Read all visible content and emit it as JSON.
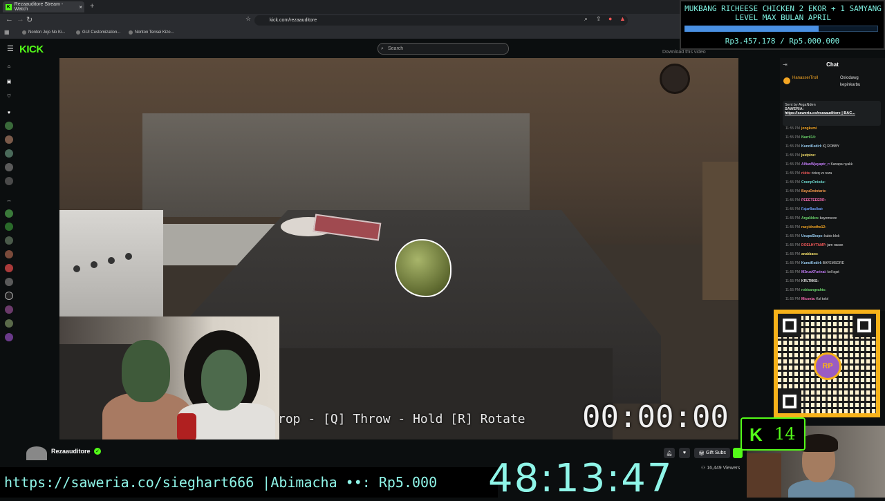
{
  "browser": {
    "tab_title": "Rezaauditore Stream - Watch",
    "url": "kick.com/rezaauditore",
    "bookmarks": [
      "Nonton Jojo No Ki...",
      "GUI Customization...",
      "Nonton Tensei Kizo..."
    ]
  },
  "kick": {
    "logo": "KICK",
    "search_placeholder": "Search",
    "download_hint": "Download this video"
  },
  "game": {
    "controls_hint": "rop - [Q] Throw - Hold [R] Rotate",
    "timer": "00:00:00"
  },
  "stream": {
    "streamer": "Rezaauditore",
    "gift_subs": "Gift Subs",
    "viewers": "16,449 Viewers"
  },
  "chat": {
    "title": "Chat",
    "leaders": [
      "HanasserTroll",
      "Oslodawg",
      "kepinkarbu"
    ],
    "pinned_sender": "Sent by ArgaNden",
    "pinned_label": "SAWERIA:",
    "pinned_url": "https://saweria.co/rezaauditore | BAC...",
    "messages": [
      {
        "time": "11:55 PM",
        "user": "jongkumi",
        "text": "",
        "color": "#f5a623"
      },
      {
        "time": "11:55 PM",
        "user": "Nazril14:",
        "text": "",
        "color": "#6ad16a"
      },
      {
        "time": "11:55 PM",
        "user": "KunciKedirI:",
        "text": "IQ ROBBY",
        "color": "#9ad0f5"
      },
      {
        "time": "11:55 PM",
        "user": "justpine:",
        "text": "",
        "color": "#f5e06a"
      },
      {
        "time": "11:55 PM",
        "user": "AlfianWjayaptr_r:",
        "text": "Kanapa nyakk",
        "color": "#c07af5"
      },
      {
        "time": "11:55 PM",
        "user": "rkkts:",
        "text": "rizieq vs reza",
        "color": "#f55a5a"
      },
      {
        "time": "11:55 PM",
        "user": "CrampOnioda:",
        "text": "",
        "color": "#6ad1c7"
      },
      {
        "time": "11:55 PM",
        "user": "BayuDwintaris:",
        "text": "",
        "color": "#f59a4a"
      },
      {
        "time": "11:55 PM",
        "user": "PEEETEEERR:",
        "text": "",
        "color": "#f56ab0"
      },
      {
        "time": "11:55 PM",
        "user": "FajarBaslkat:",
        "text": "",
        "color": "#6a9af5"
      },
      {
        "time": "11:55 PM",
        "user": "ArgaNden:",
        "text": "bayemsore",
        "color": "#6ad16a"
      },
      {
        "time": "11:55 PM",
        "user": "rasyidnotho12:",
        "text": "",
        "color": "#f5a623"
      },
      {
        "time": "11:55 PM",
        "user": "UcupsSkopc:",
        "text": "kubis blok",
        "color": "#9ad0f5"
      },
      {
        "time": "11:55 PM",
        "user": "DOELHYTAMP:",
        "text": "jam rawan",
        "color": "#f55a5a"
      },
      {
        "time": "11:55 PM",
        "user": "anakbaes:",
        "text": "",
        "color": "#f5e06a"
      },
      {
        "time": "11:55 PM",
        "user": "KunciKedirI:",
        "text": "BAYEMSORE",
        "color": "#9ad0f5"
      },
      {
        "time": "11:55 PM",
        "user": "M3ruaXFurinai:",
        "text": "kol bgst",
        "color": "#c07af5"
      },
      {
        "time": "11:55 PM",
        "user": "KRLTM0S:",
        "text": "",
        "color": "#ddd"
      },
      {
        "time": "11:55 PM",
        "user": "robisangeahts:",
        "text": "",
        "color": "#6ad16a"
      },
      {
        "time": "11:55 PM",
        "user": "Miconia:",
        "text": "Kol tolol",
        "color": "#f56ab0"
      }
    ]
  },
  "overlay": {
    "goal_title": "MUKBANG RICHEESE CHICKEN 2 EKOR + 1 SAMYANG LEVEL MAX BULAN APRIL",
    "goal_amount": "Rp3.457.178 / Rp5.000.000",
    "goal_progress": 0.6914,
    "qr_logo": "RP",
    "kick_count": "14",
    "ticker": "https://saweria.co/sieghart666 |Abimacha ••: Rp5.000",
    "big_timer": "48:13:47"
  },
  "colors": {
    "kick_green": "#53fc18",
    "overlay_cyan": "#8ff5e8",
    "goal_bar": "#4a90e2"
  }
}
